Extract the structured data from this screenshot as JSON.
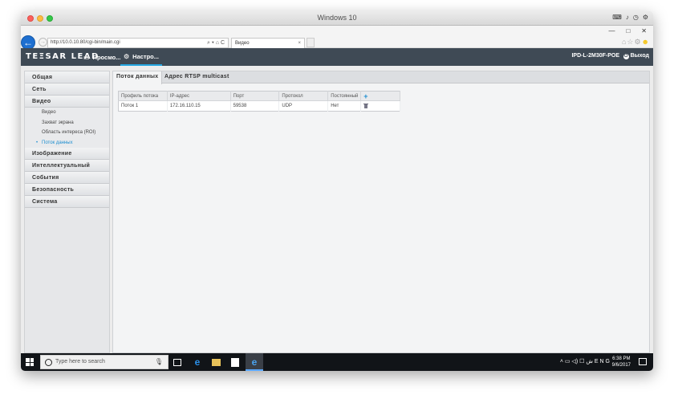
{
  "os_window": {
    "title": "Windows 10"
  },
  "browser": {
    "address": "http://10.0.10.80/cgi-bin/main.cgi",
    "address_tools": "⌕ ▾ ⌂ C",
    "tab_title": "Видео",
    "tab_close": "×",
    "back_glyph": "←",
    "forward_glyph": "→",
    "window_controls": [
      "—",
      "□",
      "✕"
    ],
    "right_icons": "⌂☆⚙"
  },
  "header": {
    "logo": "TEΞSAR LEAD",
    "nav_preview": "Просмо...",
    "nav_settings": "Настро...",
    "device_name": "IPD-L-2M30F-POE",
    "logout": "Выход",
    "preview_icon": "monitor-icon",
    "settings_icon": "gear-icon"
  },
  "sidebar": {
    "items": [
      {
        "label": "Общая"
      },
      {
        "label": "Сеть"
      },
      {
        "label": "Видео"
      },
      {
        "label": "Изображение"
      },
      {
        "label": "Интеллектуальный"
      },
      {
        "label": "События"
      },
      {
        "label": "Безопасность"
      },
      {
        "label": "Система"
      }
    ],
    "video_sub": [
      {
        "label": "Видео"
      },
      {
        "label": "Захват экрана"
      },
      {
        "label": "Область интереса (ROI)"
      },
      {
        "label": "Поток данных"
      }
    ],
    "active_bullet": "•"
  },
  "tabs": [
    {
      "label": "Поток данных"
    },
    {
      "label": "Адрес RTSP multicast"
    }
  ],
  "table": {
    "headers": [
      "Профиль потока",
      "IP-адрес",
      "Порт",
      "Протокол",
      "Постоянный"
    ],
    "add_glyph": "+",
    "rows": [
      {
        "profile": "Поток 1",
        "ip": "172.16.110.15",
        "port": "59538",
        "protocol": "UDP",
        "permanent": "Нет"
      }
    ]
  },
  "taskbar": {
    "search_placeholder": "Type here to search",
    "time": "6:38 PM",
    "date": "9/6/2017",
    "tray": "˄ ▭ ◁) ☐ ش ENG"
  }
}
